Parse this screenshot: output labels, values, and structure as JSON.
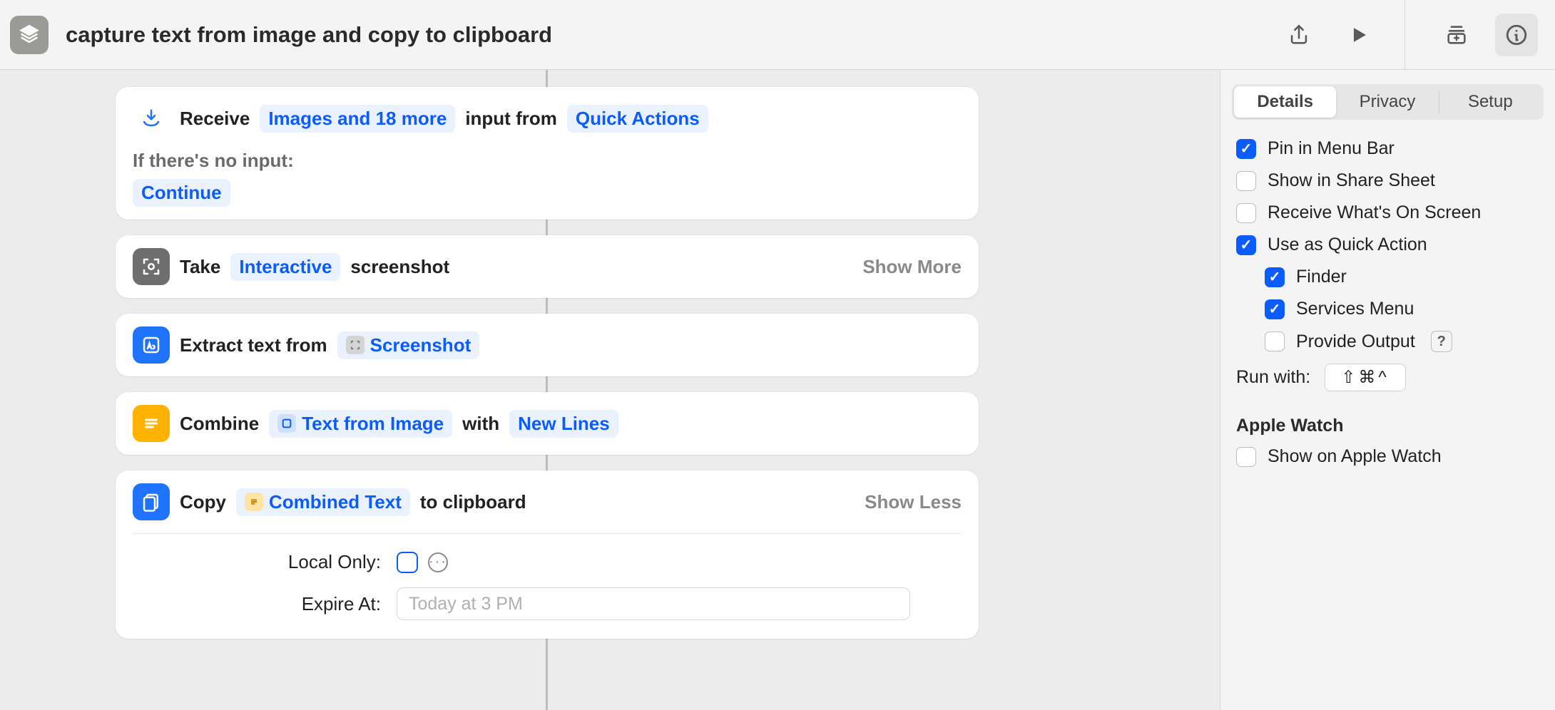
{
  "toolbar": {
    "title": "capture text from image and copy to clipboard"
  },
  "workflow": {
    "receive": {
      "verb": "Receive",
      "input_types": "Images and 18 more",
      "from_label": "input from",
      "source": "Quick Actions",
      "no_input_label": "If there's no input:",
      "no_input_action": "Continue"
    },
    "screenshot": {
      "verb": "Take",
      "mode": "Interactive",
      "noun": "screenshot",
      "expand": "Show More"
    },
    "extract": {
      "verb": "Extract text from",
      "source": "Screenshot"
    },
    "combine": {
      "verb": "Combine",
      "source": "Text from Image",
      "with_label": "with",
      "joiner": "New Lines"
    },
    "copy": {
      "verb": "Copy",
      "source": "Combined Text",
      "dest_label": "to clipboard",
      "expand": "Show Less",
      "local_only_label": "Local Only:",
      "expire_label": "Expire At:",
      "expire_placeholder": "Today at 3 PM"
    }
  },
  "inspector": {
    "tabs": {
      "details": "Details",
      "privacy": "Privacy",
      "setup": "Setup"
    },
    "options": {
      "pin_menubar": {
        "label": "Pin in Menu Bar",
        "checked": true
      },
      "share_sheet": {
        "label": "Show in Share Sheet",
        "checked": false
      },
      "receive_screen": {
        "label": "Receive What's On Screen",
        "checked": false
      },
      "quick_action": {
        "label": "Use as Quick Action",
        "checked": true
      },
      "finder": {
        "label": "Finder",
        "checked": true
      },
      "services_menu": {
        "label": "Services Menu",
        "checked": true
      },
      "provide_output": {
        "label": "Provide Output",
        "checked": false
      }
    },
    "run_with": {
      "label": "Run with:",
      "shortcut": "⇧⌘^"
    },
    "watch_section": "Apple Watch",
    "show_on_watch": {
      "label": "Show on Apple Watch",
      "checked": false
    }
  }
}
